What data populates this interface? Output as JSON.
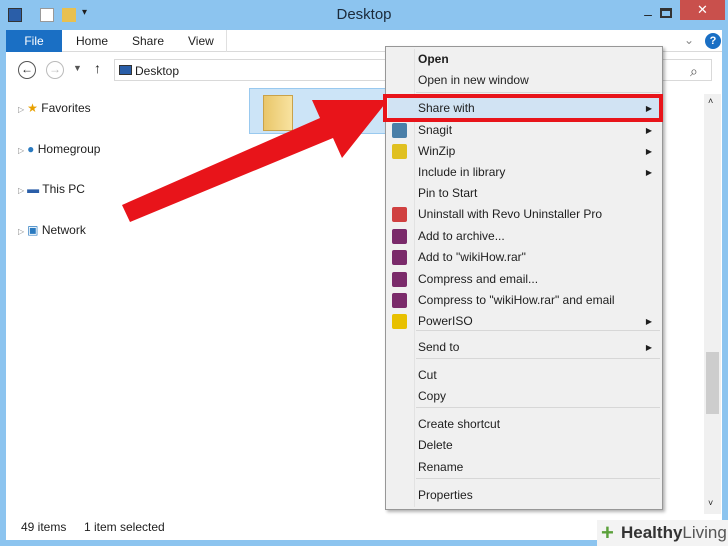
{
  "window": {
    "title": "Desktop",
    "close": "✕",
    "minimize": "–"
  },
  "ribbon": {
    "tabs": [
      "File",
      "Home",
      "Share",
      "View"
    ],
    "help": "?",
    "expand": "⌄"
  },
  "address": {
    "path": "Desktop",
    "search_icon": "⌕"
  },
  "nav": [
    "Favorites",
    "Homegroup",
    "This PC",
    "Network"
  ],
  "status": {
    "count": "49 items",
    "selected": "1 item selected"
  },
  "menu": {
    "items": [
      {
        "label": "Open",
        "bold": true
      },
      {
        "label": "Open in new window"
      },
      {
        "label": "Share with",
        "sub": true
      },
      {
        "label": "Snagit",
        "sub": true,
        "icon": "snagit-icon",
        "color": "#4a7fa8"
      },
      {
        "label": "WinZip",
        "sub": true,
        "icon": "winzip-icon",
        "color": "#e0c020"
      },
      {
        "label": "Include in library",
        "sub": true
      },
      {
        "label": "Pin to Start"
      },
      {
        "label": "Uninstall with Revo Uninstaller Pro",
        "icon": "revo-icon",
        "color": "#d04040"
      },
      {
        "label": "Add to archive...",
        "icon": "winrar-icon",
        "color": "#7a2a6a"
      },
      {
        "label": "Add to \"wikiHow.rar\"",
        "icon": "winrar-icon",
        "color": "#7a2a6a"
      },
      {
        "label": "Compress and email...",
        "icon": "winrar-icon",
        "color": "#7a2a6a"
      },
      {
        "label": "Compress to \"wikiHow.rar\" and email",
        "icon": "winrar-icon",
        "color": "#7a2a6a"
      },
      {
        "label": "PowerISO",
        "sub": true,
        "icon": "poweriso-icon",
        "color": "#e8c000"
      },
      {
        "label": "Send to",
        "sub": true
      },
      {
        "label": "Cut"
      },
      {
        "label": "Copy"
      },
      {
        "label": "Create shortcut"
      },
      {
        "label": "Delete"
      },
      {
        "label": "Rename"
      },
      {
        "label": "Properties"
      }
    ]
  },
  "watermark": {
    "brand": "Healthy",
    "suffix": "Living"
  },
  "colors": {
    "highlight": "#e8141a",
    "accent": "#1a6fc4"
  }
}
